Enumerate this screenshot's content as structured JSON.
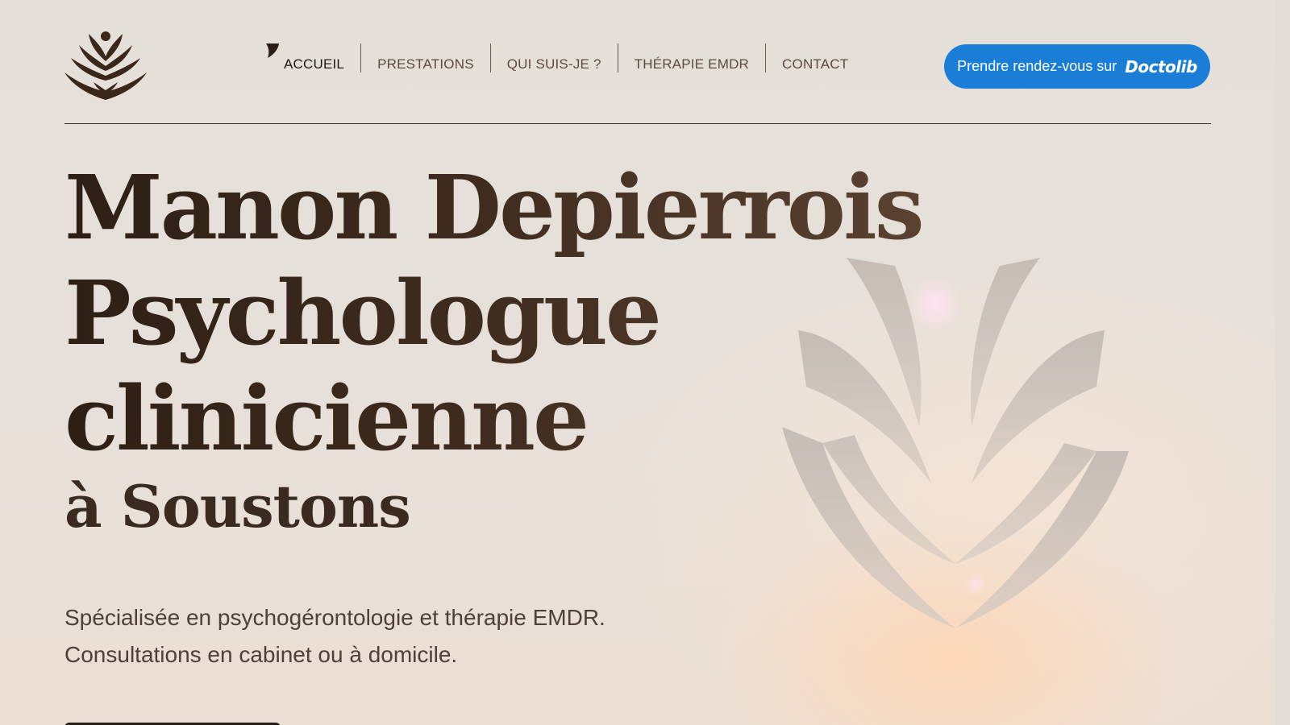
{
  "nav": {
    "items": [
      {
        "label": "ACCUEIL",
        "active": true
      },
      {
        "label": "PRESTATIONS",
        "active": false
      },
      {
        "label": "QUI SUIS-JE ?",
        "active": false
      },
      {
        "label": "THÉRAPIE EMDR",
        "active": false
      },
      {
        "label": "CONTACT",
        "active": false
      }
    ]
  },
  "cta": {
    "label": "Prendre rendez-vous sur",
    "brand": "Doctolib",
    "color": "#1a7ed6"
  },
  "hero": {
    "title_lines": [
      "Manon Depierrois",
      "Psychologue",
      "clinicienne"
    ],
    "subtitle": "à Soustons",
    "intro_lines": [
      "Spécialisée en psychogérontologie et thérapie EMDR.",
      "Consultations en cabinet ou à domicile."
    ]
  },
  "icons": {
    "logo": "lotus-hands-logo-icon",
    "hero_art": "lotus-hands-sculpture-icon"
  },
  "colors": {
    "background": "#e6dfd9",
    "text_dark": "#3c2a1e",
    "accent": "#1a7ed6"
  }
}
